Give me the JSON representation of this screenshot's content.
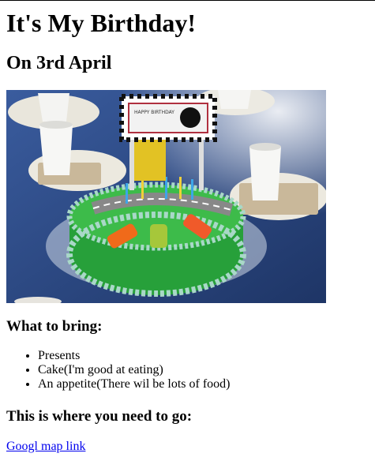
{
  "page": {
    "title": "It's My Birthday!",
    "subtitle": "On 3rd April",
    "photo_sign_text": "HAPPY BIRTHDAY",
    "bring_heading": "What to bring:",
    "bring_items": [
      "Presents",
      "Cake(I'm good at eating)",
      "An appetite(There wil be lots of food)"
    ],
    "location_heading": "This is where you need to go:",
    "map_link": "Googl map link"
  },
  "colors": {
    "link": "#0000ee",
    "table": "#2b4a86",
    "cake_frosting": "#2fa83a",
    "cake_trim": "#a9d8c8"
  }
}
